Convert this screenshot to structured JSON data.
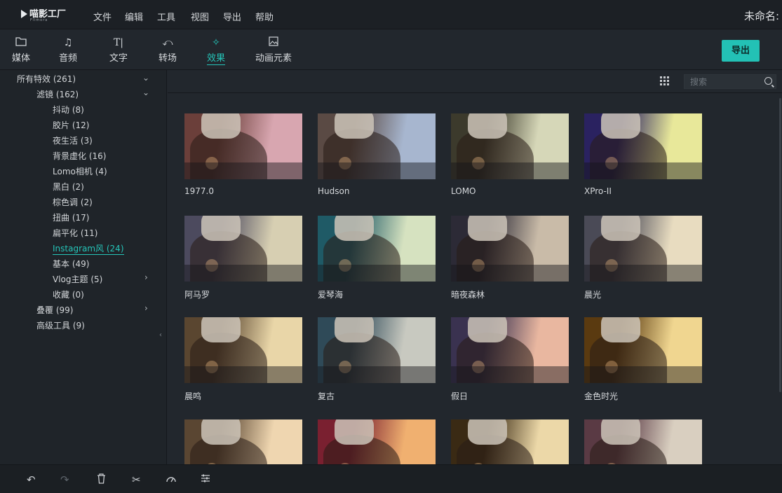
{
  "app": {
    "logo_text": "喵影工厂",
    "logo_sub": "Filmora",
    "doc_title": "未命名:"
  },
  "menu": [
    "文件",
    "编辑",
    "工具",
    "视图",
    "导出",
    "帮助"
  ],
  "toolbar": {
    "tabs": [
      {
        "label": "媒体",
        "icon": "folder-icon"
      },
      {
        "label": "音频",
        "icon": "music-note-icon"
      },
      {
        "label": "文字",
        "icon": "text-icon"
      },
      {
        "label": "转场",
        "icon": "transition-icon"
      },
      {
        "label": "效果",
        "icon": "effects-icon"
      },
      {
        "label": "动画元素",
        "icon": "image-element-icon"
      }
    ],
    "active_tab": "效果",
    "export_label": "导出"
  },
  "sidebar": {
    "items": [
      {
        "label": "所有特效 (261)",
        "level": 0,
        "expand": "down"
      },
      {
        "label": "滤镜 (162)",
        "level": 1,
        "expand": "down"
      },
      {
        "label": "抖动 (8)",
        "level": 2
      },
      {
        "label": "胶片 (12)",
        "level": 2
      },
      {
        "label": "夜生活 (3)",
        "level": 2
      },
      {
        "label": "背景虚化 (16)",
        "level": 2
      },
      {
        "label": "Lomo相机 (4)",
        "level": 2
      },
      {
        "label": "黑白 (2)",
        "level": 2
      },
      {
        "label": "棕色调 (2)",
        "level": 2
      },
      {
        "label": "扭曲 (17)",
        "level": 2
      },
      {
        "label": "扁平化 (11)",
        "level": 2
      },
      {
        "label": "Instagram风 (24)",
        "level": 2,
        "active": true
      },
      {
        "label": "基本 (49)",
        "level": 2
      },
      {
        "label": "Vlog主题 (5)",
        "level": 2,
        "expand": "right"
      },
      {
        "label": "收藏 (0)",
        "level": 2
      },
      {
        "label": "叠覆 (99)",
        "level": 1,
        "expand": "right"
      },
      {
        "label": "高级工具 (9)",
        "level": 1
      }
    ]
  },
  "search": {
    "placeholder": "搜索"
  },
  "effects": [
    {
      "label": "1977.0",
      "tint": "#d8a6b0",
      "shade": "#6b3f3a"
    },
    {
      "label": "Hudson",
      "tint": "#a7b6cf",
      "shade": "#5a4a44"
    },
    {
      "label": "LOMO",
      "tint": "#d6d7b8",
      "shade": "#3c3a2c"
    },
    {
      "label": "XPro-II",
      "tint": "#e8e89a",
      "shade": "#2a2260"
    },
    {
      "label": "阿马罗",
      "tint": "#d7cfb2",
      "shade": "#4c4a5e"
    },
    {
      "label": "爱琴海",
      "tint": "#d6e2c0",
      "shade": "#1f5a66"
    },
    {
      "label": "暗夜森林",
      "tint": "#c9bba8",
      "shade": "#2c2a36"
    },
    {
      "label": "晨光",
      "tint": "#e8dcc0",
      "shade": "#4a4a56"
    },
    {
      "label": "晨鸣",
      "tint": "#e9d6a8",
      "shade": "#5a4630"
    },
    {
      "label": "复古",
      "tint": "#c8c9c0",
      "shade": "#2f4a58"
    },
    {
      "label": "假日",
      "tint": "#e9b7a0",
      "shade": "#3a3250"
    },
    {
      "label": "金色时光",
      "tint": "#f0d690",
      "shade": "#5a3a10"
    },
    {
      "label": "",
      "tint": "#efd6b0",
      "shade": "#5a4632"
    },
    {
      "label": "",
      "tint": "#f0b070",
      "shade": "#7a2030"
    },
    {
      "label": "",
      "tint": "#ecd8a8",
      "shade": "#3a2a14"
    },
    {
      "label": "",
      "tint": "#d9cfc0",
      "shade": "#5a3a44"
    }
  ],
  "bottombar": {
    "icons": [
      "undo-icon",
      "redo-icon",
      "delete-icon",
      "cut-icon",
      "speed-icon",
      "adjust-icon"
    ]
  }
}
